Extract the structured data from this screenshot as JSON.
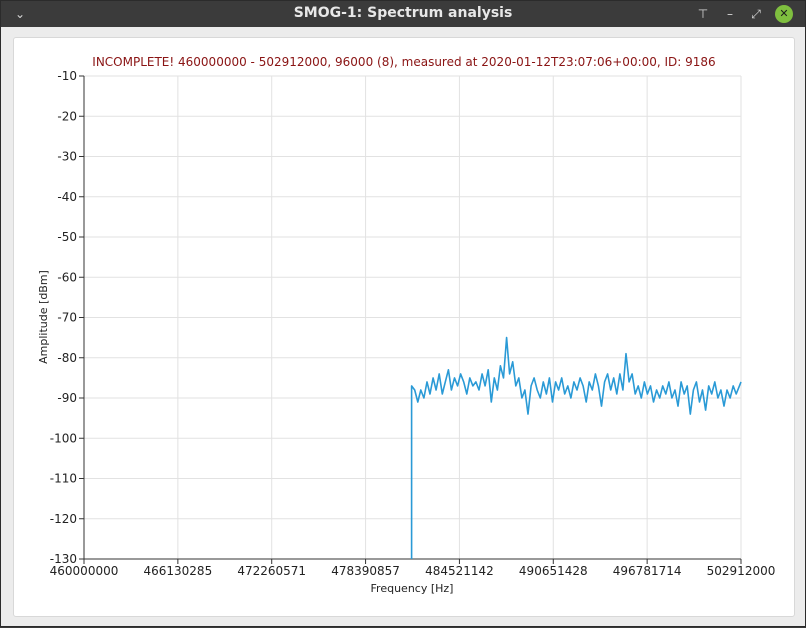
{
  "window": {
    "title": "SMOG-1: Spectrum analysis",
    "menu_icon": "chevron-down-icon",
    "buttons": [
      "pin-icon",
      "minimize-icon",
      "restore-icon",
      "close-icon"
    ]
  },
  "chart_data": {
    "type": "line",
    "title": "INCOMPLETE! 460000000 - 502912000, 96000 (8), measured at 2020-01-12T23:07:06+00:00, ID: 9186",
    "xlabel": "Frequency [Hz]",
    "ylabel": "Amplitude [dBm]",
    "xlim": [
      460000000,
      502912000
    ],
    "ylim": [
      -130,
      -10
    ],
    "x_ticks": [
      460000000,
      466130285,
      472260571,
      478390857,
      484521142,
      490651428,
      496781714,
      502912000
    ],
    "y_ticks": [
      -130,
      -120,
      -110,
      -100,
      -90,
      -80,
      -70,
      -60,
      -50,
      -40,
      -30,
      -20,
      -10
    ],
    "grid": true,
    "series_color": "#2a9ad6",
    "series": [
      {
        "x_start": 481500000,
        "x_step": 96000,
        "step_mark_every": 1,
        "values_note_free": true,
        "points": [
          [
            481400000,
            -130
          ],
          [
            481400000,
            -87
          ],
          [
            481600000,
            -88
          ],
          [
            481800000,
            -91
          ],
          [
            482000000,
            -88
          ],
          [
            482200000,
            -90
          ],
          [
            482400000,
            -86
          ],
          [
            482600000,
            -89
          ],
          [
            482800000,
            -85
          ],
          [
            483000000,
            -88
          ],
          [
            483200000,
            -84
          ],
          [
            483400000,
            -89
          ],
          [
            483600000,
            -86
          ],
          [
            483800000,
            -83
          ],
          [
            484000000,
            -88
          ],
          [
            484200000,
            -85
          ],
          [
            484400000,
            -87
          ],
          [
            484600000,
            -84
          ],
          [
            484800000,
            -86
          ],
          [
            485000000,
            -89
          ],
          [
            485200000,
            -85
          ],
          [
            485400000,
            -87
          ],
          [
            485600000,
            -86
          ],
          [
            485800000,
            -88
          ],
          [
            486000000,
            -84
          ],
          [
            486200000,
            -87
          ],
          [
            486400000,
            -83
          ],
          [
            486600000,
            -91
          ],
          [
            486800000,
            -85
          ],
          [
            487000000,
            -88
          ],
          [
            487200000,
            -82
          ],
          [
            487400000,
            -85
          ],
          [
            487600000,
            -75
          ],
          [
            487800000,
            -84
          ],
          [
            488000000,
            -81
          ],
          [
            488200000,
            -87
          ],
          [
            488400000,
            -85
          ],
          [
            488600000,
            -90
          ],
          [
            488800000,
            -88
          ],
          [
            489000000,
            -94
          ],
          [
            489200000,
            -87
          ],
          [
            489400000,
            -85
          ],
          [
            489600000,
            -88
          ],
          [
            489800000,
            -90
          ],
          [
            490000000,
            -86
          ],
          [
            490200000,
            -89
          ],
          [
            490400000,
            -85
          ],
          [
            490600000,
            -91
          ],
          [
            490800000,
            -86
          ],
          [
            491000000,
            -88
          ],
          [
            491200000,
            -85
          ],
          [
            491400000,
            -89
          ],
          [
            491600000,
            -87
          ],
          [
            491800000,
            -90
          ],
          [
            492000000,
            -86
          ],
          [
            492200000,
            -88
          ],
          [
            492400000,
            -85
          ],
          [
            492600000,
            -87
          ],
          [
            492800000,
            -91
          ],
          [
            493000000,
            -86
          ],
          [
            493200000,
            -88
          ],
          [
            493400000,
            -84
          ],
          [
            493600000,
            -87
          ],
          [
            493800000,
            -92
          ],
          [
            494000000,
            -86
          ],
          [
            494200000,
            -84
          ],
          [
            494400000,
            -88
          ],
          [
            494600000,
            -85
          ],
          [
            494800000,
            -89
          ],
          [
            495000000,
            -84
          ],
          [
            495200000,
            -88
          ],
          [
            495400000,
            -79
          ],
          [
            495600000,
            -86
          ],
          [
            495800000,
            -84
          ],
          [
            496000000,
            -89
          ],
          [
            496200000,
            -87
          ],
          [
            496400000,
            -90
          ],
          [
            496600000,
            -86
          ],
          [
            496800000,
            -89
          ],
          [
            497000000,
            -87
          ],
          [
            497200000,
            -91
          ],
          [
            497400000,
            -88
          ],
          [
            497600000,
            -90
          ],
          [
            497800000,
            -87
          ],
          [
            498000000,
            -89
          ],
          [
            498200000,
            -86
          ],
          [
            498400000,
            -90
          ],
          [
            498600000,
            -88
          ],
          [
            498800000,
            -92
          ],
          [
            499000000,
            -86
          ],
          [
            499200000,
            -89
          ],
          [
            499400000,
            -87
          ],
          [
            499600000,
            -94
          ],
          [
            499800000,
            -88
          ],
          [
            500000000,
            -86
          ],
          [
            500200000,
            -91
          ],
          [
            500400000,
            -88
          ],
          [
            500600000,
            -93
          ],
          [
            500800000,
            -87
          ],
          [
            501000000,
            -89
          ],
          [
            501200000,
            -86
          ],
          [
            501400000,
            -90
          ],
          [
            501600000,
            -88
          ],
          [
            501800000,
            -92
          ],
          [
            502000000,
            -88
          ],
          [
            502200000,
            -90
          ],
          [
            502400000,
            -87
          ],
          [
            502600000,
            -89
          ],
          [
            502912000,
            -86
          ]
        ]
      }
    ]
  }
}
